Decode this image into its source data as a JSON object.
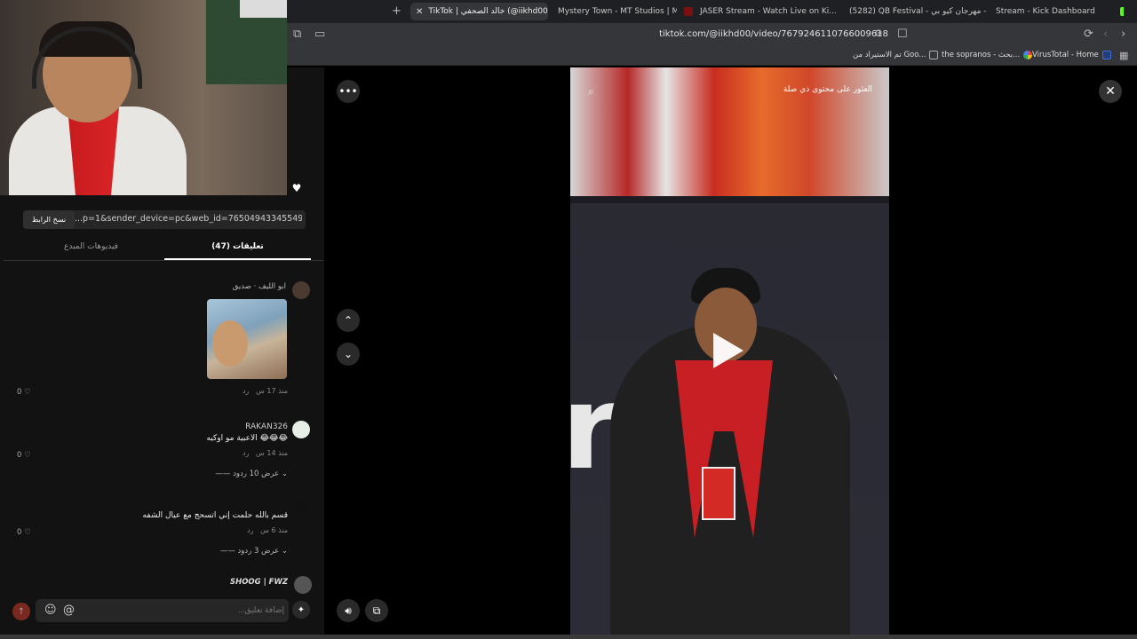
{
  "browser": {
    "tabs": [
      {
        "label": "TikTok | خالد الصحفي (@iikhd00)",
        "active": true
      },
      {
        "label": "Mystery Town - MT Studios | MTRP |",
        "active": false
      },
      {
        "label": "JASER Stream - Watch Live on Ki...",
        "active": false
      },
      {
        "label": "(5282) QB Festival - مهرجان كيو بي - Y...",
        "active": false
      },
      {
        "label": "Stream - Kick Dashboard",
        "active": false
      }
    ],
    "url": "tiktok.com/@iikhd00/video/7679246110766009618",
    "bookmarks": [
      {
        "label": "VirusTotal - Home",
        "icon": "virustotal-icon"
      },
      {
        "label": "the sopranos - بحث...",
        "icon": "google-icon"
      },
      {
        "label": "تم الاستيراد من Goo...",
        "icon": "folder-icon"
      }
    ]
  },
  "comments_panel": {
    "copy_link": {
      "button": "نسخ الرابط",
      "link": "...p=1&sender_device=pc&web_id=7650494334554981896"
    },
    "tabs": [
      {
        "label": "(47) تعليقات",
        "active": true
      },
      {
        "label": "فيديوهات المبدع",
        "active": false
      }
    ],
    "comments": [
      {
        "name": "ابو الليف · صديق",
        "text": "",
        "time": "منذ 17 س",
        "reply": "رد",
        "likes": "0",
        "has_image": true
      },
      {
        "name": "RAKAN326",
        "text": "الاعبية مو اوكيه 😂😂😂",
        "time": "منذ 14 س",
        "reply": "رد",
        "likes": "0",
        "view_replies": "عرض 10 ردود"
      },
      {
        "name": "",
        "text": "قسم بالله حلمت إني اتسحج مع عيال الشفه",
        "time": "منذ 6 س",
        "reply": "رد",
        "likes": "0",
        "view_replies": "عرض 3 ردود"
      },
      {
        "name": "SHOOG | FWZ",
        "text": "",
        "time": "",
        "reply": "",
        "likes": ""
      }
    ],
    "input_placeholder": "إضافة تعليق..."
  },
  "video": {
    "search_placeholder": "العثور على محتوى ذي صلة",
    "logo_text": "rap",
    "reg_mark": "®"
  },
  "colors": {
    "accent": "#fe2c55",
    "background": "#000000"
  }
}
